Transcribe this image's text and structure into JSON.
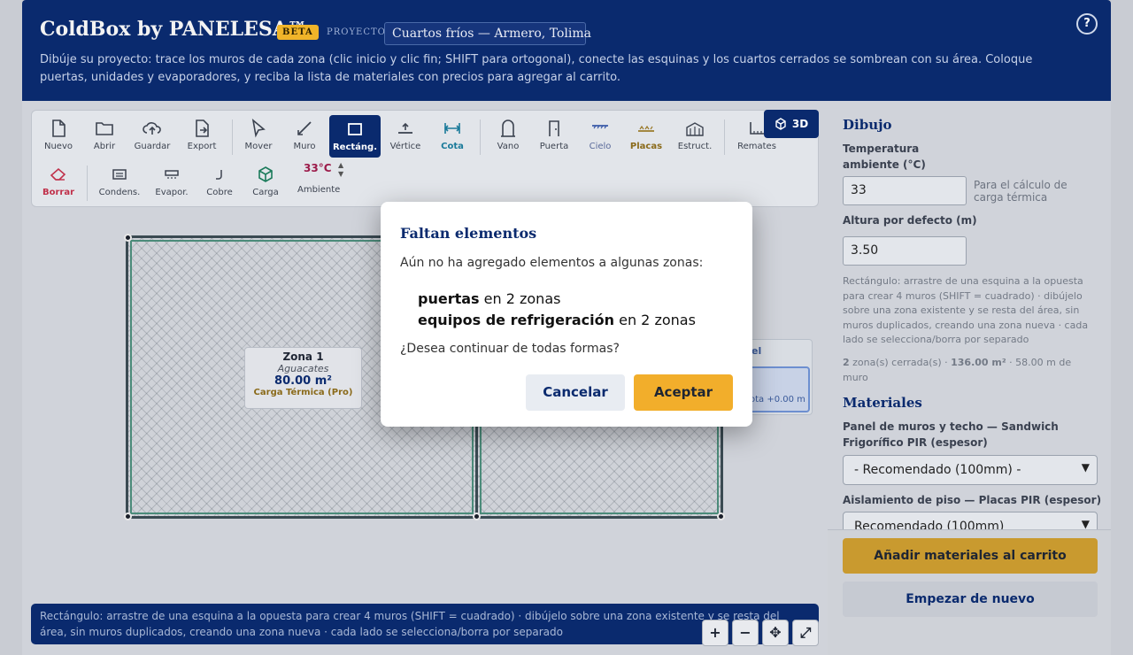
{
  "header": {
    "brand": "ColdBox by PANELESA™",
    "beta": "BETA",
    "project_label": "PROYECTO",
    "project_name": "Cuartos fríos — Armero, Tolima",
    "help": "?",
    "description": "Dibúje su proyecto: trace los muros de cada zona (clic inicio y clic fin; SHIFT para ortogonal), conecte las esquinas y los cuartos cerrados se sombrean con su área. Coloque puertas, unidades y evaporadores, y reciba la lista de materiales con precios para agregar al carrito."
  },
  "toolbar": {
    "row1": [
      {
        "label": "Nuevo",
        "icon": "file-icon"
      },
      {
        "label": "Abrir",
        "icon": "folder-icon"
      },
      {
        "label": "Guardar",
        "icon": "cloud-upload-icon"
      },
      {
        "label": "Export",
        "icon": "file-export-icon"
      },
      {
        "label": "Mover",
        "icon": "pointer-icon"
      },
      {
        "label": "Muro",
        "icon": "line-icon"
      },
      {
        "label": "Rectáng.",
        "icon": "rectangle-icon"
      },
      {
        "label": "Vértice",
        "icon": "vertex-icon"
      },
      {
        "label": "Cota",
        "icon": "dimension-icon"
      },
      {
        "label": "Vano",
        "icon": "opening-icon"
      },
      {
        "label": "Puerta",
        "icon": "door-icon"
      },
      {
        "label": "Cielo",
        "icon": "ceiling-icon"
      },
      {
        "label": "Placas",
        "icon": "plates-icon"
      },
      {
        "label": "Estruct.",
        "icon": "structure-icon"
      },
      {
        "label": "Remates",
        "icon": "trim-icon"
      }
    ],
    "row2": [
      {
        "label": "Borrar",
        "icon": "eraser-icon"
      },
      {
        "label": "Condens.",
        "icon": "condenser-icon"
      },
      {
        "label": "Evapor.",
        "icon": "evaporator-icon"
      },
      {
        "label": "Cobre",
        "icon": "copper-pipe-icon"
      },
      {
        "label": "Carga",
        "icon": "cube-icon"
      }
    ],
    "temperature": "33°C",
    "temperature_label": "Ambiente",
    "view3d": "3D"
  },
  "canvas": {
    "zone_name": "Zona 1",
    "zone_type": "Aguacates",
    "zone_area": "80.00 m²",
    "zone_load": "Carga Térmica (Pro)",
    "side_card_title": "el",
    "side_card_text": "ota +0.00 m"
  },
  "status": "Rectángulo: arrastre de una esquina a la opuesta para crear 4 muros (SHIFT = cuadrado) · dibújelo sobre una zona existente y se resta del área, sin muros duplicados, creando una zona nueva · cada lado se selecciona/borra por separado",
  "zoom": {
    "plus": "+",
    "minus": "−",
    "pan": "✥",
    "fit": "⤢"
  },
  "sidebar": {
    "dibujo_title": "Dibujo",
    "temp_label": "Temperatura ambiente (°C)",
    "temp_value": "33",
    "temp_hint": "Para el cálculo de carga térmica",
    "height_label": "Altura por defecto (m)",
    "height_value": "3.50",
    "rect_help": "Rectángulo: arrastre de una esquina a la opuesta para crear 4 muros (SHIFT = cuadrado) · dibújelo sobre una zona existente y se resta del área, sin muros duplicados, creando una zona nueva · cada lado se selecciona/borra por separado",
    "stats_count": "2",
    "stats_text1": " zona(s) cerrada(s) · ",
    "stats_area": "136.00 m²",
    "stats_text2": " · 58.00 m de muro",
    "materiales_title": "Materiales",
    "panel_label": "Panel de muros y techo — Sandwich Frigorífico PIR (espesor)",
    "panel_value": "- Recomendado (100mm) -",
    "floor_label": "Aislamiento de piso — Placas PIR (espesor)",
    "floor_value": "Recomendado (100mm)",
    "add_cart": "Añadir materiales al carrito",
    "restart": "Empezar de nuevo"
  },
  "modal": {
    "title": "Faltan elementos",
    "body": "Aún no ha agregado elementos a algunas zonas:",
    "item1_bold": "puertas",
    "item1_rest": " en 2 zonas",
    "item2_bold": "equipos de refrigeración",
    "item2_rest": " en 2 zonas",
    "question": "¿Desea continuar de todas formas?",
    "cancel": "Cancelar",
    "accept": "Aceptar"
  }
}
